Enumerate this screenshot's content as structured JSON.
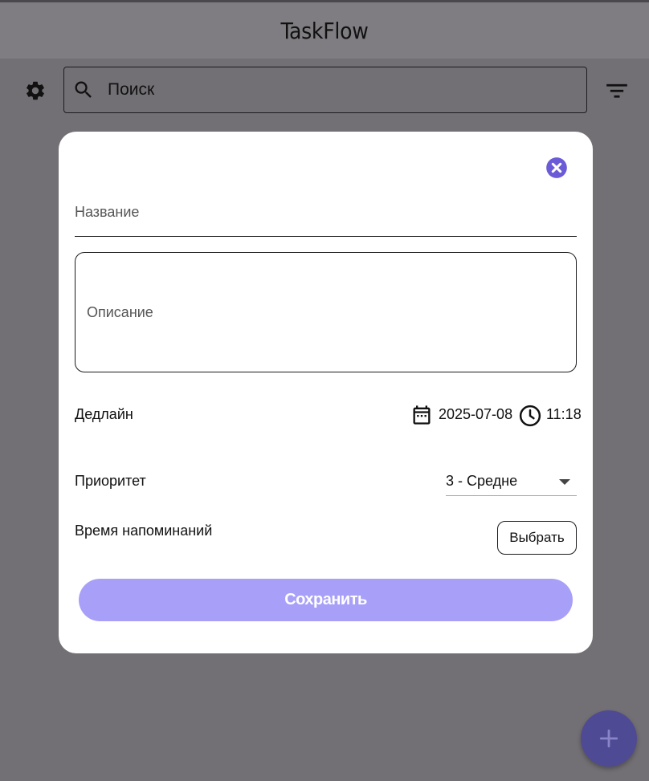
{
  "app": {
    "title": "TaskFlow"
  },
  "toolbar": {
    "search_placeholder": "Поиск",
    "settings_icon": "gear-icon",
    "filter_icon": "filter-icon"
  },
  "dialog": {
    "title_placeholder": "Название",
    "description_placeholder": "Описание",
    "deadline_label": "Дедлайн",
    "deadline_date": "2025-07-08",
    "deadline_time": "11:18",
    "priority_label": "Приоритет",
    "priority_value": "3 - Средне",
    "reminder_label": "Время напоминаний",
    "choose_button": "Выбрать",
    "save_button": "Сохранить"
  },
  "colors": {
    "overlay": "#737075",
    "save_button_bg": "#a8a0f8",
    "close_icon": "#6b5bd6",
    "fab_bg": "#4f4a94"
  }
}
